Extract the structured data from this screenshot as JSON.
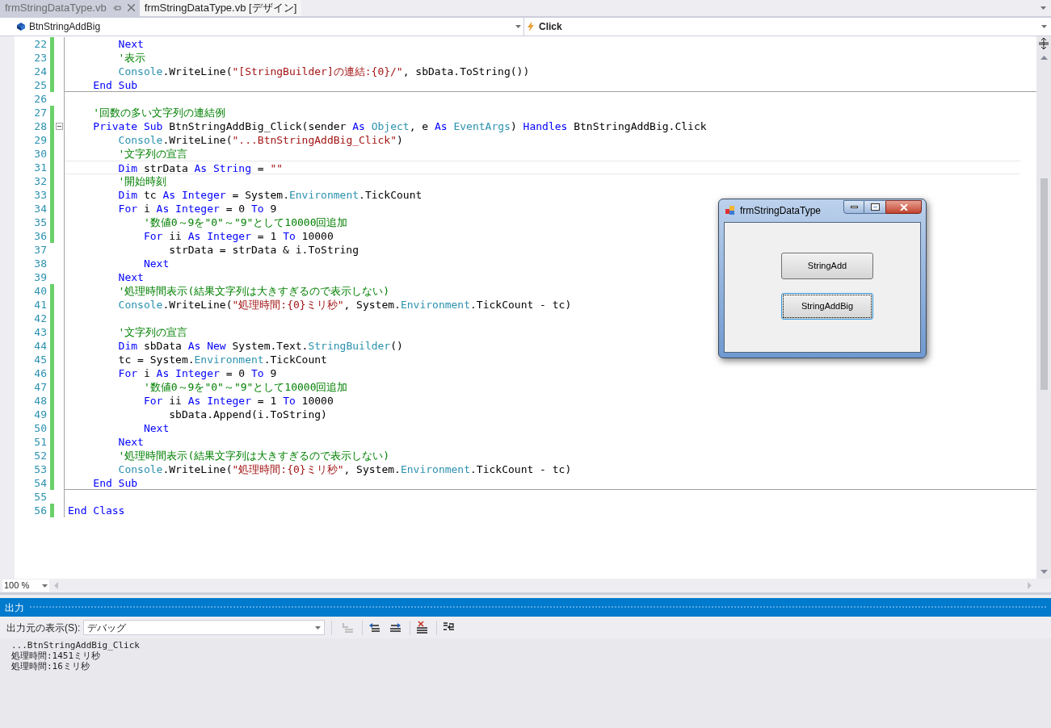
{
  "tabs": [
    {
      "label": "frmStringDataType.vb",
      "selected": true,
      "pinnable": true
    },
    {
      "label": "frmStringDataType.vb [デザイン]",
      "selected": false,
      "pinnable": false
    }
  ],
  "navigation": {
    "class_dropdown": "BtnStringAddBig",
    "method_dropdown": "Click"
  },
  "editor": {
    "lines": [
      {
        "number": "22",
        "changed": true,
        "tokens": [
          {
            "kind": "kw",
            "text": "        Next"
          }
        ]
      },
      {
        "number": "23",
        "changed": true,
        "tokens": [
          {
            "kind": "comment",
            "text": "        '表示"
          }
        ]
      },
      {
        "number": "24",
        "changed": true,
        "tokens": [
          {
            "kind": "type",
            "text": "        Console"
          },
          {
            "kind": "plain",
            "text": ".WriteLine("
          },
          {
            "kind": "str",
            "text": "\"[StringBuilder]の連結:{0}/\""
          },
          {
            "kind": "plain",
            "text": ", sbData.ToString())"
          }
        ]
      },
      {
        "number": "25",
        "changed": true,
        "separator": true,
        "tokens": [
          {
            "kind": "kw",
            "text": "    End Sub"
          }
        ]
      },
      {
        "number": "26",
        "changed": false
      },
      {
        "number": "27",
        "changed": true,
        "tokens": [
          {
            "kind": "comment",
            "text": "    '回数の多い文字列の連結例"
          }
        ]
      },
      {
        "number": "28",
        "changed": true,
        "collapsible": true,
        "tokens": [
          {
            "kind": "kw",
            "text": "    Private Sub"
          },
          {
            "kind": "plain",
            "text": " BtnStringAddBig_Click(sender "
          },
          {
            "kind": "kw",
            "text": "As"
          },
          {
            "kind": "type",
            "text": " Object"
          },
          {
            "kind": "plain",
            "text": ", e "
          },
          {
            "kind": "kw",
            "text": "As"
          },
          {
            "kind": "type",
            "text": " EventArgs"
          },
          {
            "kind": "plain",
            "text": ") "
          },
          {
            "kind": "kw",
            "text": "Handles"
          },
          {
            "kind": "plain",
            "text": " BtnStringAddBig.Click"
          }
        ]
      },
      {
        "number": "29",
        "changed": true,
        "tokens": [
          {
            "kind": "type",
            "text": "        Console"
          },
          {
            "kind": "plain",
            "text": ".WriteLine("
          },
          {
            "kind": "str",
            "text": "\"...BtnStringAddBig_Click\""
          },
          {
            "kind": "plain",
            "text": ")"
          }
        ]
      },
      {
        "number": "30",
        "changed": true,
        "tokens": [
          {
            "kind": "comment",
            "text": "        '文字列の宣言"
          }
        ]
      },
      {
        "number": "31",
        "changed": true,
        "current": true,
        "tokens": [
          {
            "kind": "kw",
            "text": "        Dim"
          },
          {
            "kind": "plain",
            "text": " strData "
          },
          {
            "kind": "kw",
            "text": "As String"
          },
          {
            "kind": "plain",
            "text": " = "
          },
          {
            "kind": "str",
            "text": "\"\""
          }
        ]
      },
      {
        "number": "32",
        "changed": true,
        "tokens": [
          {
            "kind": "comment",
            "text": "        '開始時刻"
          }
        ]
      },
      {
        "number": "33",
        "changed": true,
        "tokens": [
          {
            "kind": "kw",
            "text": "        Dim"
          },
          {
            "kind": "plain",
            "text": " tc "
          },
          {
            "kind": "kw",
            "text": "As Integer"
          },
          {
            "kind": "plain",
            "text": " = System."
          },
          {
            "kind": "type",
            "text": "Environment"
          },
          {
            "kind": "plain",
            "text": ".TickCount"
          }
        ]
      },
      {
        "number": "34",
        "changed": true,
        "tokens": [
          {
            "kind": "kw",
            "text": "        For"
          },
          {
            "kind": "plain",
            "text": " i "
          },
          {
            "kind": "kw",
            "text": "As Integer"
          },
          {
            "kind": "plain",
            "text": " = 0 "
          },
          {
            "kind": "kw",
            "text": "To"
          },
          {
            "kind": "plain",
            "text": " 9"
          }
        ]
      },
      {
        "number": "35",
        "changed": true,
        "tokens": [
          {
            "kind": "comment",
            "text": "            '数値0～9を\"0\"～\"9\"として10000回追加"
          }
        ]
      },
      {
        "number": "36",
        "changed": true,
        "tokens": [
          {
            "kind": "kw",
            "text": "            For"
          },
          {
            "kind": "plain",
            "text": " ii "
          },
          {
            "kind": "kw",
            "text": "As Integer"
          },
          {
            "kind": "plain",
            "text": " = 1 "
          },
          {
            "kind": "kw",
            "text": "To"
          },
          {
            "kind": "plain",
            "text": " 10000"
          }
        ]
      },
      {
        "number": "37",
        "changed": false,
        "tokens": [
          {
            "kind": "plain",
            "text": "                strData = strData & i.ToString"
          }
        ]
      },
      {
        "number": "38",
        "changed": false,
        "tokens": [
          {
            "kind": "kw",
            "text": "            Next"
          }
        ]
      },
      {
        "number": "39",
        "changed": false,
        "tokens": [
          {
            "kind": "kw",
            "text": "        Next"
          }
        ]
      },
      {
        "number": "40",
        "changed": true,
        "tokens": [
          {
            "kind": "comment",
            "text": "        '処理時間表示(結果文字列は大きすぎるので表示しない)"
          }
        ]
      },
      {
        "number": "41",
        "changed": true,
        "tokens": [
          {
            "kind": "type",
            "text": "        Console"
          },
          {
            "kind": "plain",
            "text": ".WriteLine("
          },
          {
            "kind": "str",
            "text": "\"処理時間:{0}ミリ秒\""
          },
          {
            "kind": "plain",
            "text": ", System."
          },
          {
            "kind": "type",
            "text": "Environment"
          },
          {
            "kind": "plain",
            "text": ".TickCount - tc)"
          }
        ]
      },
      {
        "number": "42",
        "changed": true
      },
      {
        "number": "43",
        "changed": true,
        "tokens": [
          {
            "kind": "comment",
            "text": "        '文字列の宣言"
          }
        ]
      },
      {
        "number": "44",
        "changed": true,
        "tokens": [
          {
            "kind": "kw",
            "text": "        Dim"
          },
          {
            "kind": "plain",
            "text": " sbData "
          },
          {
            "kind": "kw",
            "text": "As New"
          },
          {
            "kind": "plain",
            "text": " System.Text."
          },
          {
            "kind": "type",
            "text": "StringBuilder"
          },
          {
            "kind": "plain",
            "text": "()"
          }
        ]
      },
      {
        "number": "45",
        "changed": true,
        "tokens": [
          {
            "kind": "plain",
            "text": "        tc = System."
          },
          {
            "kind": "type",
            "text": "Environment"
          },
          {
            "kind": "plain",
            "text": ".TickCount"
          }
        ]
      },
      {
        "number": "46",
        "changed": true,
        "tokens": [
          {
            "kind": "kw",
            "text": "        For"
          },
          {
            "kind": "plain",
            "text": " i "
          },
          {
            "kind": "kw",
            "text": "As Integer"
          },
          {
            "kind": "plain",
            "text": " = 0 "
          },
          {
            "kind": "kw",
            "text": "To"
          },
          {
            "kind": "plain",
            "text": " 9"
          }
        ]
      },
      {
        "number": "47",
        "changed": true,
        "tokens": [
          {
            "kind": "comment",
            "text": "            '数値0～9を\"0\"～\"9\"として10000回追加"
          }
        ]
      },
      {
        "number": "48",
        "changed": true,
        "tokens": [
          {
            "kind": "kw",
            "text": "            For"
          },
          {
            "kind": "plain",
            "text": " ii "
          },
          {
            "kind": "kw",
            "text": "As Integer"
          },
          {
            "kind": "plain",
            "text": " = 1 "
          },
          {
            "kind": "kw",
            "text": "To"
          },
          {
            "kind": "plain",
            "text": " 10000"
          }
        ]
      },
      {
        "number": "49",
        "changed": true,
        "tokens": [
          {
            "kind": "plain",
            "text": "                sbData.Append(i.ToString)"
          }
        ]
      },
      {
        "number": "50",
        "changed": true,
        "tokens": [
          {
            "kind": "kw",
            "text": "            Next"
          }
        ]
      },
      {
        "number": "51",
        "changed": true,
        "tokens": [
          {
            "kind": "kw",
            "text": "        Next"
          }
        ]
      },
      {
        "number": "52",
        "changed": true,
        "tokens": [
          {
            "kind": "comment",
            "text": "        '処理時間表示(結果文字列は大きすぎるので表示しない)"
          }
        ]
      },
      {
        "number": "53",
        "changed": true,
        "tokens": [
          {
            "kind": "type",
            "text": "        Console"
          },
          {
            "kind": "plain",
            "text": ".WriteLine("
          },
          {
            "kind": "str",
            "text": "\"処理時間:{0}ミリ秒\""
          },
          {
            "kind": "plain",
            "text": ", System."
          },
          {
            "kind": "type",
            "text": "Environment"
          },
          {
            "kind": "plain",
            "text": ".TickCount - tc)"
          }
        ]
      },
      {
        "number": "54",
        "changed": true,
        "separator": true,
        "tokens": [
          {
            "kind": "kw",
            "text": "    End Sub"
          }
        ]
      },
      {
        "number": "55",
        "changed": false
      },
      {
        "number": "56",
        "changed": true,
        "tokens": [
          {
            "kind": "kw",
            "text": "End Class"
          }
        ]
      }
    ],
    "zoom": "100 %"
  },
  "form_window": {
    "title": "frmStringDataType",
    "buttons": [
      {
        "label": "StringAdd",
        "focused": false
      },
      {
        "label": "StringAddBig",
        "focused": true
      }
    ]
  },
  "output": {
    "title": "出力",
    "source_label": "出力元の表示(S):",
    "source_value": "デバッグ",
    "toolbar": [
      {
        "kind": "goto",
        "disabled": true
      },
      {
        "kind": "prev",
        "disabled": false
      },
      {
        "kind": "next",
        "disabled": false
      },
      {
        "kind": "clear",
        "disabled": false
      },
      {
        "kind": "wrap",
        "disabled": false
      }
    ],
    "lines": [
      "...BtnStringAddBig_Click",
      "処理時間:1451ミリ秒",
      "処理時間:16ミリ秒"
    ]
  }
}
